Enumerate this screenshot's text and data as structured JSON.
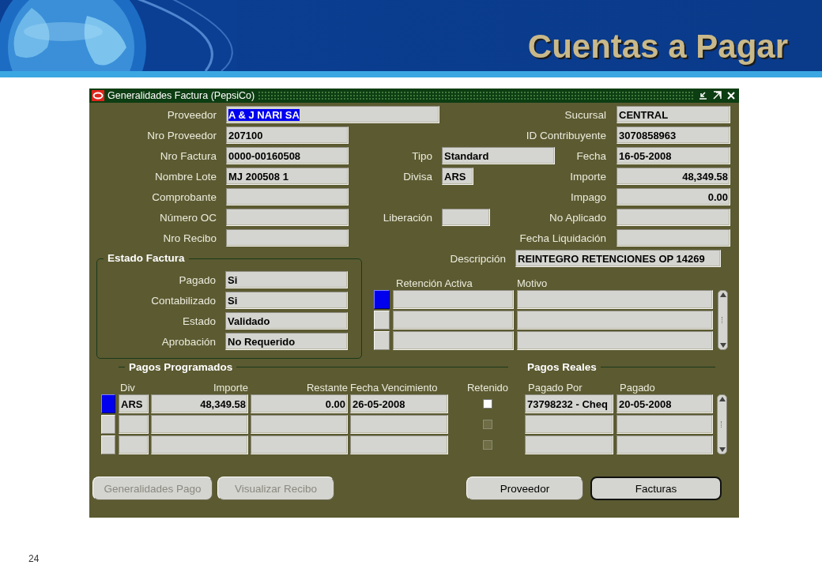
{
  "slide": {
    "title": "Cuentas a Pagar",
    "page_number": "24"
  },
  "window": {
    "title": "Generalidades Factura (PepsiCo)"
  },
  "header_rows": [
    {
      "left": {
        "label": "Proveedor",
        "value": "A & J NARI SA",
        "highlighted": true
      },
      "right": {
        "label": "Sucursal",
        "value": "CENTRAL",
        "highlighted": false
      }
    },
    {
      "left": {
        "label": "Nro Proveedor",
        "value": "207100",
        "highlighted": false
      },
      "right": {
        "label": "ID Contribuyente",
        "value": "3070858963",
        "highlighted": false
      }
    },
    {
      "left": {
        "label": "Nro Factura",
        "value": "0000-00160508",
        "highlighted": false
      },
      "middle": {
        "label": "Tipo",
        "value": "Standard",
        "highlighted": false
      },
      "right": {
        "label": "Fecha",
        "value": "16-05-2008",
        "highlighted": false
      }
    },
    {
      "left": {
        "label": "Nombre Lote",
        "value": "MJ 200508 1",
        "highlighted": false
      },
      "middle": {
        "label": "Divisa",
        "value": "ARS",
        "highlighted": false
      },
      "right": {
        "label": "Importe",
        "value": "48,349.58",
        "highlighted": false
      }
    },
    {
      "left": {
        "label": "Comprobante"
      },
      "right": {
        "label": "Impago",
        "value": "0.00",
        "highlighted": false
      }
    },
    {
      "left": {
        "label": "Número OC"
      },
      "middle": {
        "label": "Liberación"
      },
      "right": {
        "label": "No Aplicado"
      }
    },
    {
      "left": {
        "label": "Nro Recibo"
      },
      "right": {
        "label": "Fecha Liquidación"
      }
    }
  ],
  "description": {
    "label": "Descripción",
    "value": "REINTEGRO RETENCIONES OP 14269"
  },
  "estado_factura": {
    "title": "Estado Factura",
    "fields": [
      {
        "label": "Pagado",
        "value": "Si"
      },
      {
        "label": "Contabilizado",
        "value": "Si"
      },
      {
        "label": "Estado",
        "value": "Validado"
      },
      {
        "label": "Aprobación",
        "value": "No Requerido"
      }
    ]
  },
  "retenciones": {
    "columns": [
      "Retención Activa",
      "Motivo"
    ],
    "rows": [
      {
        "selected": true
      },
      {
        "selected": false
      },
      {
        "selected": false
      }
    ]
  },
  "pagos_programados": {
    "title": "Pagos Programados",
    "columns": [
      "Div",
      "Importe",
      "Restante",
      "Fecha Vencimiento"
    ]
  },
  "retenido_label": "Retenido",
  "pagos_reales": {
    "title": "Pagos Reales",
    "columns": [
      "Pagado Por",
      "Pagado"
    ]
  },
  "payment_rows": [
    {
      "selected": true,
      "programados": [
        "ARS",
        "48,349.58",
        "0.00",
        "26-05-2008"
      ],
      "retenido": {
        "checked": false,
        "disabled": false
      },
      "reales": [
        "73798232 - Cheq",
        "20-05-2008"
      ]
    },
    {
      "selected": false,
      "retenido": {
        "checked": false,
        "disabled": true
      }
    },
    {
      "selected": false,
      "retenido": {
        "checked": false,
        "disabled": true
      }
    }
  ],
  "buttons": [
    {
      "label": "Generalidades Pago",
      "disabled": true,
      "focused": false
    },
    {
      "label": "Visualizar Recibo",
      "disabled": true,
      "focused": false
    },
    {
      "label": "Proveedor",
      "disabled": false,
      "focused": false
    },
    {
      "label": "Facturas",
      "disabled": false,
      "focused": true
    }
  ]
}
